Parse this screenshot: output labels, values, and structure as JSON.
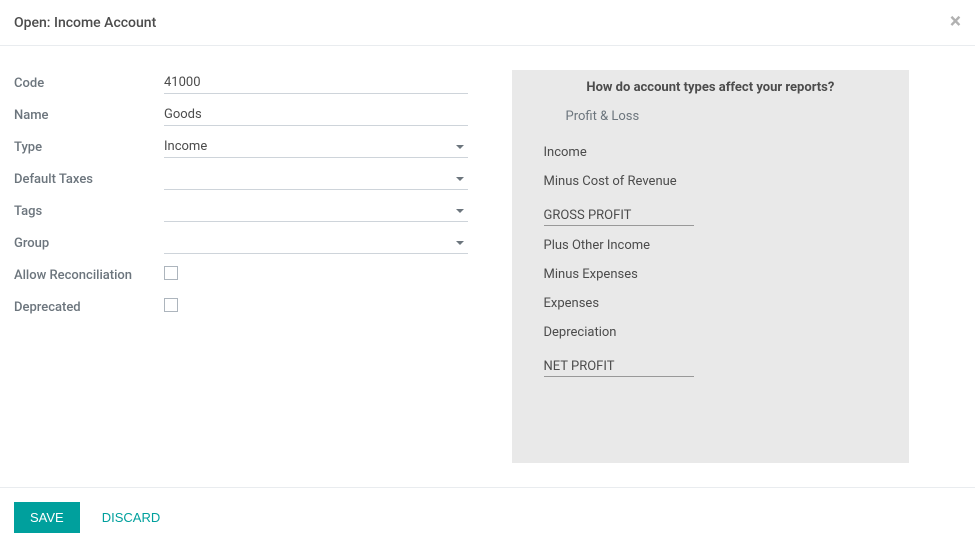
{
  "header": {
    "title": "Open: Income Account",
    "close_label": "×"
  },
  "form": {
    "labels": {
      "code": "Code",
      "name": "Name",
      "type": "Type",
      "default_taxes": "Default Taxes",
      "tags": "Tags",
      "group": "Group",
      "allow_reconciliation": "Allow Reconciliation",
      "deprecated": "Deprecated"
    },
    "values": {
      "code": "41000",
      "name": "Goods",
      "type": "Income",
      "default_taxes": "",
      "tags": "",
      "group": "",
      "allow_reconciliation": false,
      "deprecated": false
    }
  },
  "info": {
    "title": "How do account types affect your reports?",
    "subtitle": "Profit & Loss",
    "items": [
      {
        "text": "Income",
        "divider": false
      },
      {
        "text": "Minus Cost of Revenue",
        "divider": false
      },
      {
        "text": "GROSS PROFIT",
        "divider": true
      },
      {
        "text": "Plus Other Income",
        "divider": false
      },
      {
        "text": "Minus Expenses",
        "divider": false
      },
      {
        "text": "Expenses",
        "divider": false
      },
      {
        "text": "Depreciation",
        "divider": false
      },
      {
        "text": "NET PROFIT",
        "divider": true
      }
    ]
  },
  "footer": {
    "save_label": "Save",
    "discard_label": "Discard"
  }
}
